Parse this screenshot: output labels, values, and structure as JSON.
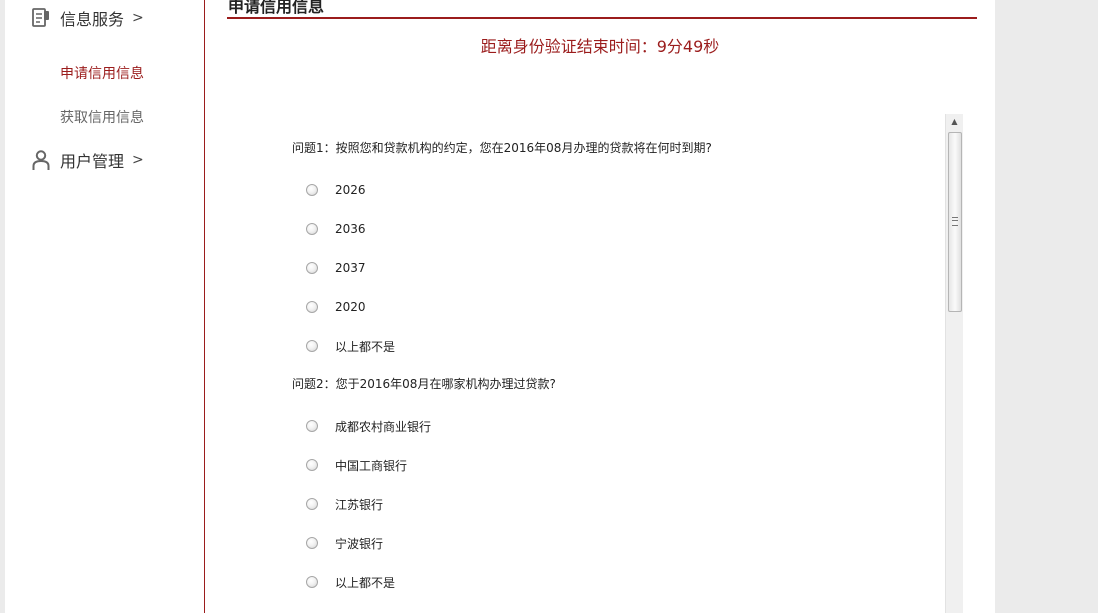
{
  "sidebar": {
    "groups": [
      {
        "label": "信息服务",
        "chevron": ">",
        "icon": "document-icon"
      },
      {
        "label": "用户管理",
        "chevron": ">",
        "icon": "user-icon"
      }
    ],
    "sub_items": [
      {
        "label": "申请信用信息",
        "active": true
      },
      {
        "label": "获取信用信息",
        "active": false
      }
    ]
  },
  "main": {
    "section_title": "申请信用信息",
    "countdown": "距离身份验证结束时间：9分49秒"
  },
  "questions": [
    {
      "text": "问题1：按照您和贷款机构的约定，您在2016年08月办理的贷款将在何时到期?",
      "options": [
        "2026",
        "2036",
        "2037",
        "2020",
        "以上都不是"
      ]
    },
    {
      "text": "问题2：您于2016年08月在哪家机构办理过贷款?",
      "options": [
        "成都农村商业银行",
        "中国工商银行",
        "江苏银行",
        "宁波银行",
        "以上都不是"
      ]
    }
  ],
  "colors": {
    "accent": "#9b1c1c",
    "background": "#ebebeb",
    "panel": "#ffffff"
  }
}
